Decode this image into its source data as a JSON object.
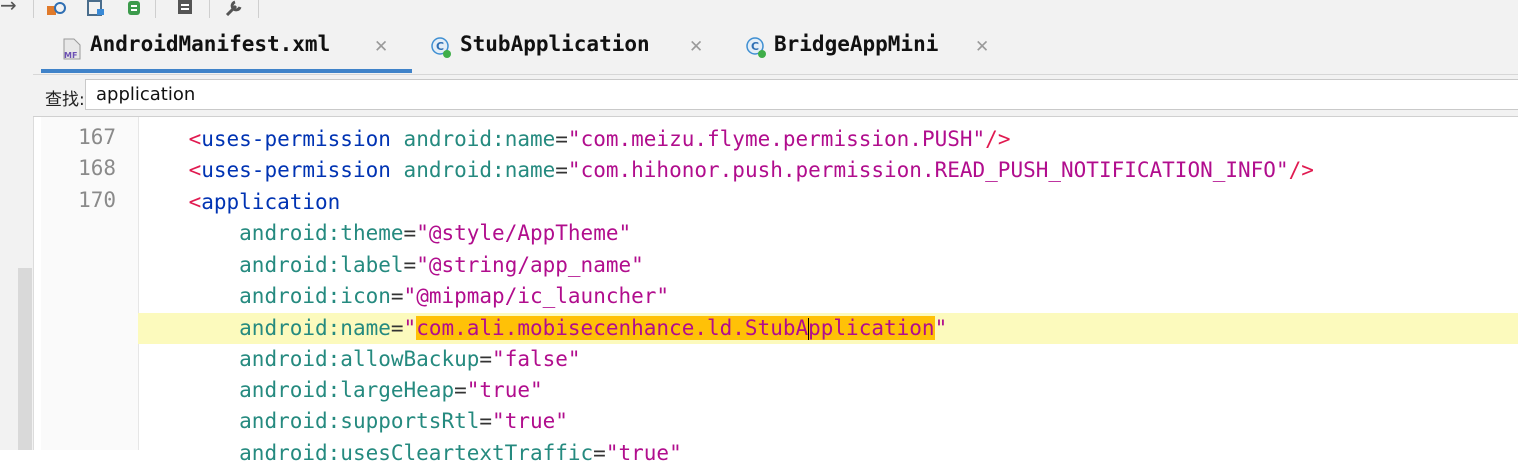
{
  "toolbar": {
    "back_icon": "arrow-right-icon",
    "buttons": [
      "debug-attach-icon",
      "layout-inspector-icon",
      "gradle-sync-icon",
      "document-icon",
      "build-wrench-icon"
    ]
  },
  "tabs": [
    {
      "label": "AndroidManifest.xml",
      "icon": "manifest-file-icon",
      "icon_text": "MF",
      "active": true
    },
    {
      "label": "StubApplication",
      "icon": "class-icon",
      "icon_text": "C",
      "active": false
    },
    {
      "label": "BridgeAppMini",
      "icon": "class-icon",
      "icon_text": "C",
      "active": false
    }
  ],
  "search": {
    "label": "查找:",
    "value": "application"
  },
  "editor": {
    "line_numbers": [
      "167",
      "168",
      "170"
    ],
    "lines": [
      {
        "indent": "    ",
        "tag": "uses-permission",
        "attr": "android:name",
        "value": "com.meizu.flyme.permission.PUSH",
        "close": "/>"
      },
      {
        "indent": "    ",
        "tag": "uses-permission",
        "attr": "android:name",
        "value": "com.hihonor.push.permission.READ_PUSH_NOTIFICATION_INFO",
        "close": "/>"
      },
      {
        "indent": "    ",
        "tag": "application"
      },
      {
        "indent": "        ",
        "attr": "android:theme",
        "value": "@style/AppTheme"
      },
      {
        "indent": "        ",
        "attr": "android:label",
        "value": "@string/app_name"
      },
      {
        "indent": "        ",
        "attr": "android:icon",
        "value": "@mipmap/ic_launcher"
      },
      {
        "indent": "        ",
        "attr": "android:name",
        "value_before": "com.ali.mobisecenhance.ld.StubA",
        "value_after": "pplication",
        "highlighted": true
      },
      {
        "indent": "        ",
        "attr": "android:allowBackup",
        "value": "false"
      },
      {
        "indent": "        ",
        "attr": "android:largeHeap",
        "value": "true"
      },
      {
        "indent": "        ",
        "attr": "android:supportsRtl",
        "value": "true"
      },
      {
        "indent": "        ",
        "attr": "android:usesCleartextTraffic",
        "value": "true"
      }
    ]
  },
  "colors": {
    "tag": "#0033b3",
    "bracket": "#e01a50",
    "attribute": "#258a7f",
    "value": "#b10d8d",
    "search_match": "#ffc107",
    "current_line": "#fcfabd",
    "active_tab_underline": "#4083c9"
  }
}
